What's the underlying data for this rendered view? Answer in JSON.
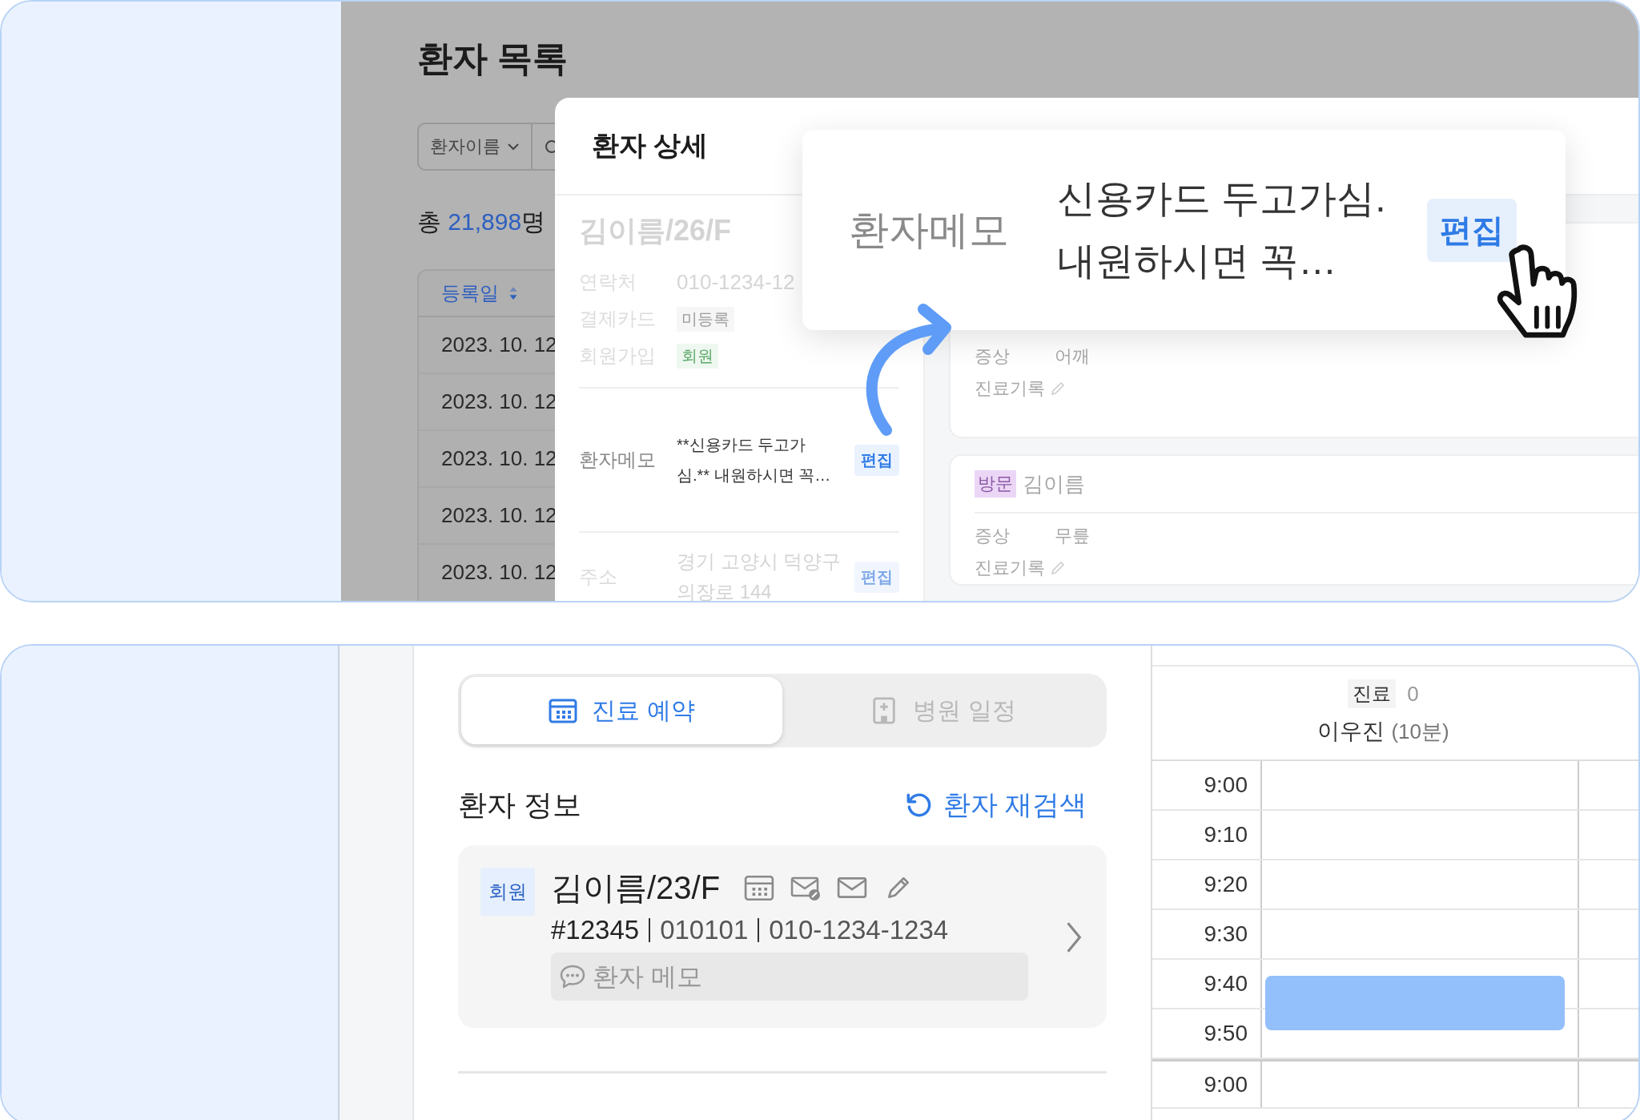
{
  "list_page": {
    "title": "환자 목록",
    "search": {
      "filter": "환자이름"
    },
    "total": {
      "prefix": "총",
      "count": "21,898",
      "suffix": "명"
    },
    "table": {
      "column": {
        "label": "등록일",
        "sorted": true
      },
      "rows": [
        "2023. 10. 12",
        "2023. 10. 12",
        "2023. 10. 12",
        "2023. 10. 12",
        "2023. 10. 12"
      ]
    }
  },
  "detail": {
    "title": "환자 상세",
    "patient": "김이름/26/F",
    "fields": [
      {
        "label": "연락처",
        "value": "010-1234-12",
        "kind": "text"
      },
      {
        "label": "결제카드",
        "value": "미등록",
        "kind": "tag"
      },
      {
        "label": "회원가입",
        "value": "회원",
        "kind": "member-tag"
      }
    ],
    "memo": {
      "label": "환자메모",
      "lines": [
        "**신용카드 두고가",
        "심.** 내원하시면 꼭…"
      ],
      "action": "편집"
    },
    "address": {
      "label": "주소",
      "lines": [
        "경기 고양시 덕양구",
        "의장로 144"
      ],
      "action": "편집"
    },
    "visits": [
      {
        "fields": [
          {
            "label": "증상",
            "value": "어깨",
            "kind": "text"
          },
          {
            "label": "진료기록",
            "kind": "edit"
          }
        ]
      },
      {
        "tag": "방문",
        "name": "김이름",
        "fields": [
          {
            "label": "증상",
            "value": "무릎",
            "kind": "text"
          },
          {
            "label": "진료기록",
            "kind": "edit"
          }
        ]
      }
    ]
  },
  "memo_popup": {
    "label": "환자메모",
    "lines": [
      "신용카드 두고가심.",
      "내원하시면 꼭…"
    ],
    "action": "편집"
  },
  "booking": {
    "tabs": [
      {
        "label": "진료 예약",
        "selected": true
      },
      {
        "label": "병원 일정",
        "selected": false
      }
    ],
    "section_title": "환자 정보",
    "research": "환자 재검색",
    "patient": {
      "badge": "회원",
      "name": "김이름/23/F",
      "ids": [
        "#12345",
        "010101",
        "010-1234-1234"
      ],
      "memo_placeholder": "환자 메모"
    }
  },
  "schedule": {
    "category": "진료",
    "count": "0",
    "doctor": "이우진",
    "duration": "(10분)",
    "slots": [
      {
        "time": "9:00",
        "booked": false,
        "section_start": false
      },
      {
        "time": "9:10",
        "booked": false,
        "section_start": false
      },
      {
        "time": "9:20",
        "booked": false,
        "section_start": false
      },
      {
        "time": "9:30",
        "booked": false,
        "section_start": false
      },
      {
        "time": "9:40",
        "booked": true,
        "section_start": false
      },
      {
        "time": "9:50",
        "booked": false,
        "section_start": false
      },
      {
        "time": "9:00",
        "booked": false,
        "section_start": true
      }
    ]
  }
}
